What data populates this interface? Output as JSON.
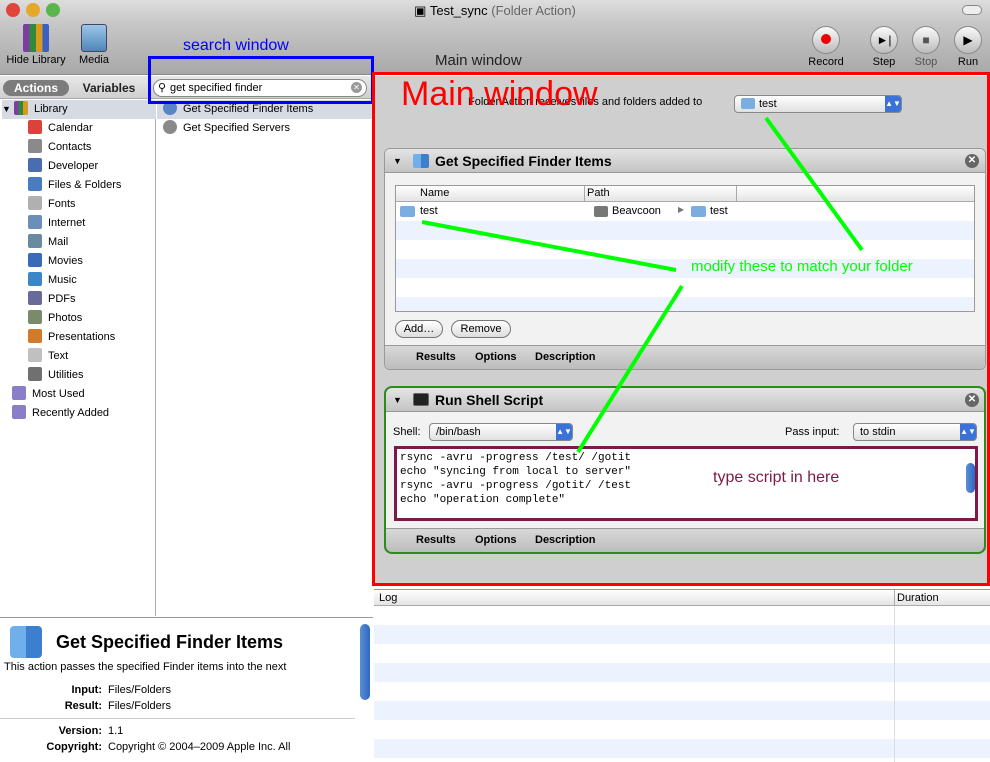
{
  "window": {
    "title": "Test_sync",
    "subtitle": "(Folder Action)"
  },
  "toolbar": {
    "hide_library": "Hide Library",
    "media": "Media",
    "record": "Record",
    "step": "Step",
    "stop": "Stop",
    "run": "Run"
  },
  "tabs": {
    "actions": "Actions",
    "variables": "Variables"
  },
  "search": {
    "value": "get specified finder"
  },
  "library": {
    "root": "Library",
    "items": [
      "Calendar",
      "Contacts",
      "Developer",
      "Files & Folders",
      "Fonts",
      "Internet",
      "Mail",
      "Movies",
      "Music",
      "PDFs",
      "Photos",
      "Presentations",
      "Text",
      "Utilities"
    ],
    "most_used": "Most Used",
    "recently_added": "Recently Added"
  },
  "results": [
    "Get Specified Finder Items",
    "Get Specified Servers"
  ],
  "description": {
    "title": "Get Specified Finder Items",
    "text": "This action passes the specified Finder items into the next",
    "input_label": "Input:",
    "input_value": "Files/Folders",
    "result_label": "Result:",
    "result_value": "Files/Folders",
    "version_label": "Version:",
    "version_value": "1.1",
    "copyright_label": "Copyright:",
    "copyright_value": "Copyright © 2004–2009 Apple Inc.  All"
  },
  "workflow": {
    "receives_label": "Folder Action receives files and folders added to",
    "folder_value": "test"
  },
  "action1": {
    "title": "Get Specified Finder Items",
    "col_name": "Name",
    "col_path": "Path",
    "row_name": "test",
    "row_path_volume": "Beavcoon",
    "row_path_folder": "test",
    "add_button": "Add…",
    "remove_button": "Remove",
    "footer_results": "Results",
    "footer_options": "Options",
    "footer_description": "Description"
  },
  "action2": {
    "title": "Run Shell Script",
    "shell_label": "Shell:",
    "shell_value": "/bin/bash",
    "pass_input_label": "Pass input:",
    "pass_input_value": "to stdin",
    "script_lines": [
      "rsync -avru -progress /test/ /gotit",
      "echo \"syncing from local to server\"",
      "rsync -avru -progress /gotit/ /test",
      "echo \"operation complete\""
    ],
    "footer_results": "Results",
    "footer_options": "Options",
    "footer_description": "Description"
  },
  "log": {
    "col_log": "Log",
    "col_duration": "Duration"
  },
  "annotations": {
    "search_window": "search window",
    "main_window_small": "Main window",
    "main_window_big": "Main window",
    "modify": "modify these to match your folder",
    "type_script": "type script in here"
  },
  "colors": {
    "red": "#ff0000",
    "blue": "#0000ff",
    "green": "#00ff00",
    "purple": "#7a1a4a",
    "accent": "#3b72d9"
  }
}
